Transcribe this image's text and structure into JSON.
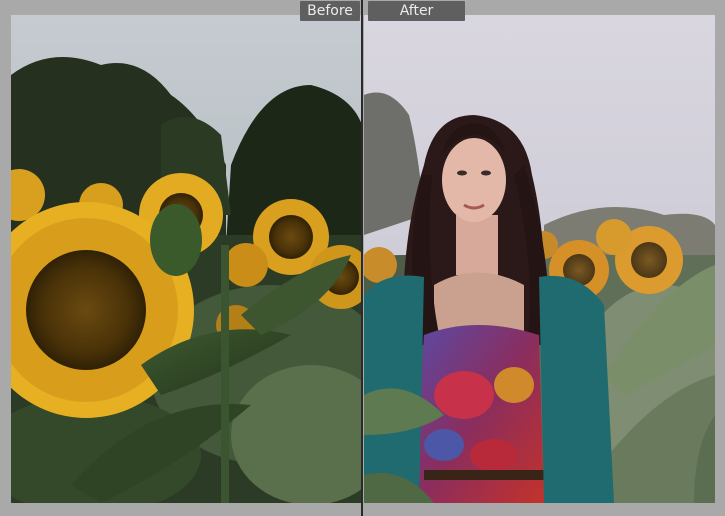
{
  "compare_view": {
    "before_label": "Before",
    "after_label": "After"
  },
  "colors": {
    "background": "#a9a9a9",
    "label_tab": "#5f5f5f",
    "label_text": "#ececec",
    "divider": "#2a2a2a"
  }
}
